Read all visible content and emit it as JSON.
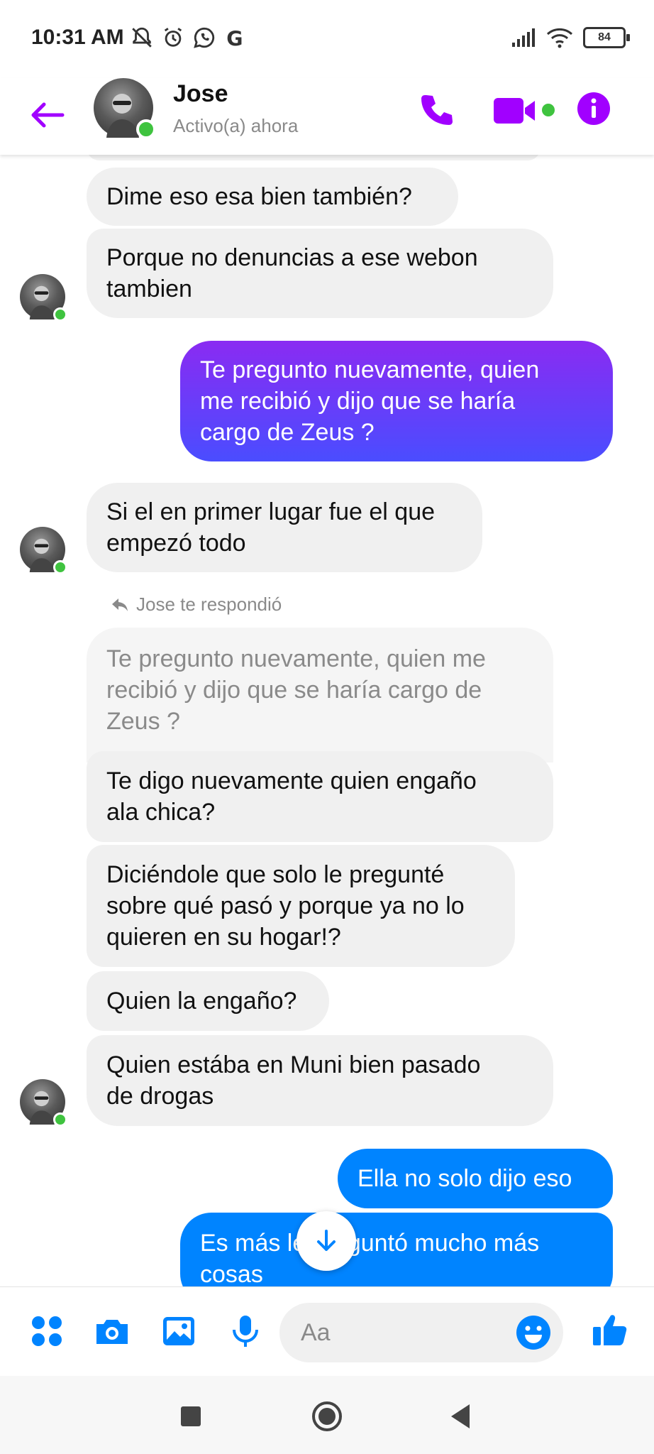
{
  "status_bar": {
    "time": "10:31 AM",
    "battery": "84",
    "icons": [
      "notifications-off-icon",
      "alarm-icon",
      "whatsapp-icon",
      "google-icon",
      "signal-icon",
      "wifi-icon",
      "battery-icon"
    ]
  },
  "header": {
    "contact_name": "Jose",
    "contact_status": "Activo(a) ahora",
    "accent_color": "#a100ff",
    "online_color": "#3fc33f"
  },
  "messages": [
    {
      "from": "contact",
      "text": "Dime eso esa bien también?"
    },
    {
      "from": "contact",
      "text": "Porque no denuncias a ese webon\ntambien"
    },
    {
      "from": "me",
      "text": "Te pregunto nuevamente, quien\nme recibió y dijo que se haría\ncargo de Zeus ?"
    },
    {
      "from": "contact",
      "text": "Si el en primer lugar fue el que\nempezó todo"
    },
    {
      "from": "contact",
      "reply_label": "Jose te respondió",
      "quoted_text": "Te pregunto nuevamente, quien me\nrecibió y dijo que se haría cargo de\nZeus ?"
    },
    {
      "from": "contact",
      "text": "Te digo nuevamente quien engaño\nala chica?"
    },
    {
      "from": "contact",
      "text": "Diciéndole que solo le pregunté\nsobre qué pasó y porque ya no lo\nquieren en su hogar!?"
    },
    {
      "from": "contact",
      "text": "Quien la engaño?"
    },
    {
      "from": "contact",
      "text": "Quien estába en Muni bien pasado\nde drogas"
    },
    {
      "from": "me",
      "text": "Ella no solo dijo eso"
    },
    {
      "from": "me",
      "text": "Es más le preguntó mucho más\ncosas"
    }
  ],
  "composer": {
    "placeholder": "Aa",
    "tools": [
      "apps-icon",
      "camera-icon",
      "gallery-icon",
      "microphone-icon"
    ],
    "accent_color": "#0084ff"
  },
  "colors": {
    "incoming_bubble": "#f0f0f0",
    "outgoing_gradient_top": "#8a2bf2",
    "outgoing_gradient_bottom": "#4a4dff",
    "outgoing_blue": "#0084ff"
  }
}
